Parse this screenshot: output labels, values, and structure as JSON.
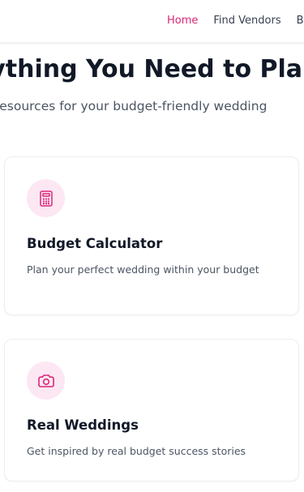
{
  "nav": {
    "links": [
      {
        "label": "Home",
        "active": true
      },
      {
        "label": "Find Vendors",
        "active": false
      },
      {
        "label": "Blog",
        "active": false
      }
    ]
  },
  "hero": {
    "title": "Everything You Need to Plan",
    "subtitle": "The tools and resources for your budget-friendly wedding"
  },
  "cards": [
    {
      "icon": "calculator-icon",
      "title": "Budget Calculator",
      "description": "Plan your perfect wedding within your budget"
    },
    {
      "icon": "camera-icon",
      "title": "Real Weddings",
      "description": "Get inspired by real budget success stories"
    }
  ],
  "colors": {
    "accent": "#db2777",
    "icon_bg": "#fce7f3",
    "text_primary": "#111827",
    "text_secondary": "#4b5563"
  }
}
